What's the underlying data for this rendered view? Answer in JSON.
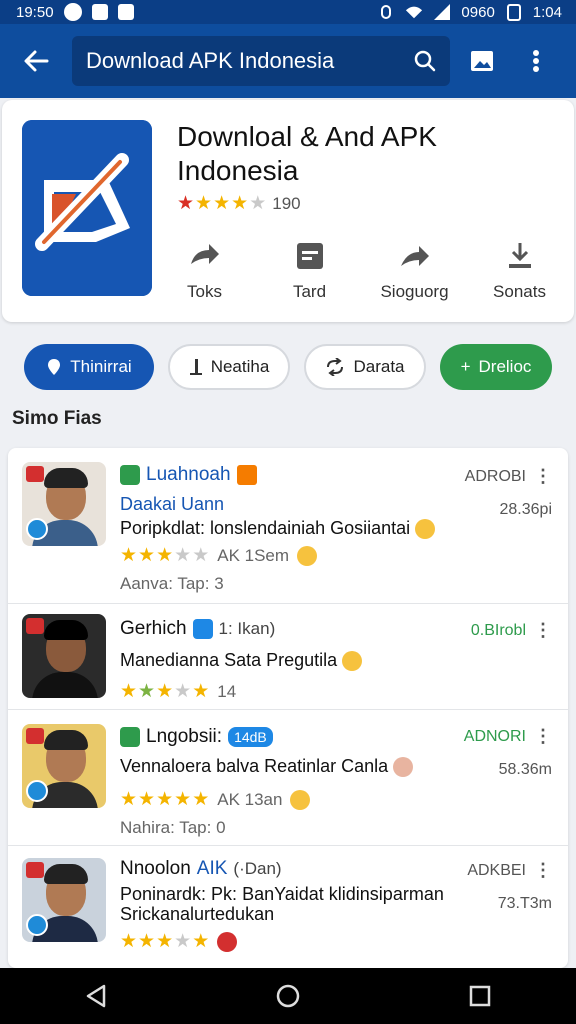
{
  "status_bar": {
    "time": "19:50",
    "right_text": "0960",
    "clock": "1:04"
  },
  "toolbar": {
    "query": "Download APK Indonesia"
  },
  "app": {
    "title": "Downloal & And APK Indonesia",
    "rating_count": "190",
    "actions": [
      {
        "label": "Toks",
        "icon": "share-arrow-icon"
      },
      {
        "label": "Tard",
        "icon": "calendar-icon"
      },
      {
        "label": "Sioguorg",
        "icon": "forward-icon"
      },
      {
        "label": "Sonats",
        "icon": "download-icon"
      }
    ]
  },
  "chips": [
    {
      "label": "Thinirrai",
      "icon": "pin-icon"
    },
    {
      "label": "Neatiha",
      "icon": "bar-icon"
    },
    {
      "label": "Darata",
      "icon": "refresh-icon"
    },
    {
      "label": "Drelioc",
      "icon": "plus-icon"
    }
  ],
  "section_title": "Simo Fias",
  "list": [
    {
      "title": "Luahnoah",
      "line1": "Daakai Uann",
      "line2": "Poripkdlat: lonslendainiah Gosiiantai",
      "meta": "AK 1Sem",
      "foot": "Aanva: Tap: 3",
      "label": "ADROBI",
      "time": "28.36pi"
    },
    {
      "title": "Gerhich",
      "title_sub": "1: Ikan)",
      "line1": "Manedianna Sata Pregutila",
      "meta": "14",
      "label": "0.BIrobl",
      "time": ""
    },
    {
      "title": "Lngobsii:",
      "pill": "14dB",
      "line1": "Vennaloera balva Reatinlar Canla",
      "meta": "AK 13an",
      "foot": "Nahira: Tap: 0",
      "label": "ADNORI",
      "time": "58.36m"
    },
    {
      "title": "Nnoolon",
      "title_accent": "AIK",
      "title_sub": "(·Dan)",
      "line1": "Poninardk: Pk: BanYaidat klidinsiparman",
      "line2": "Srickanalurtedukan",
      "label": "ADKBEI",
      "time": "73.T3m"
    }
  ]
}
